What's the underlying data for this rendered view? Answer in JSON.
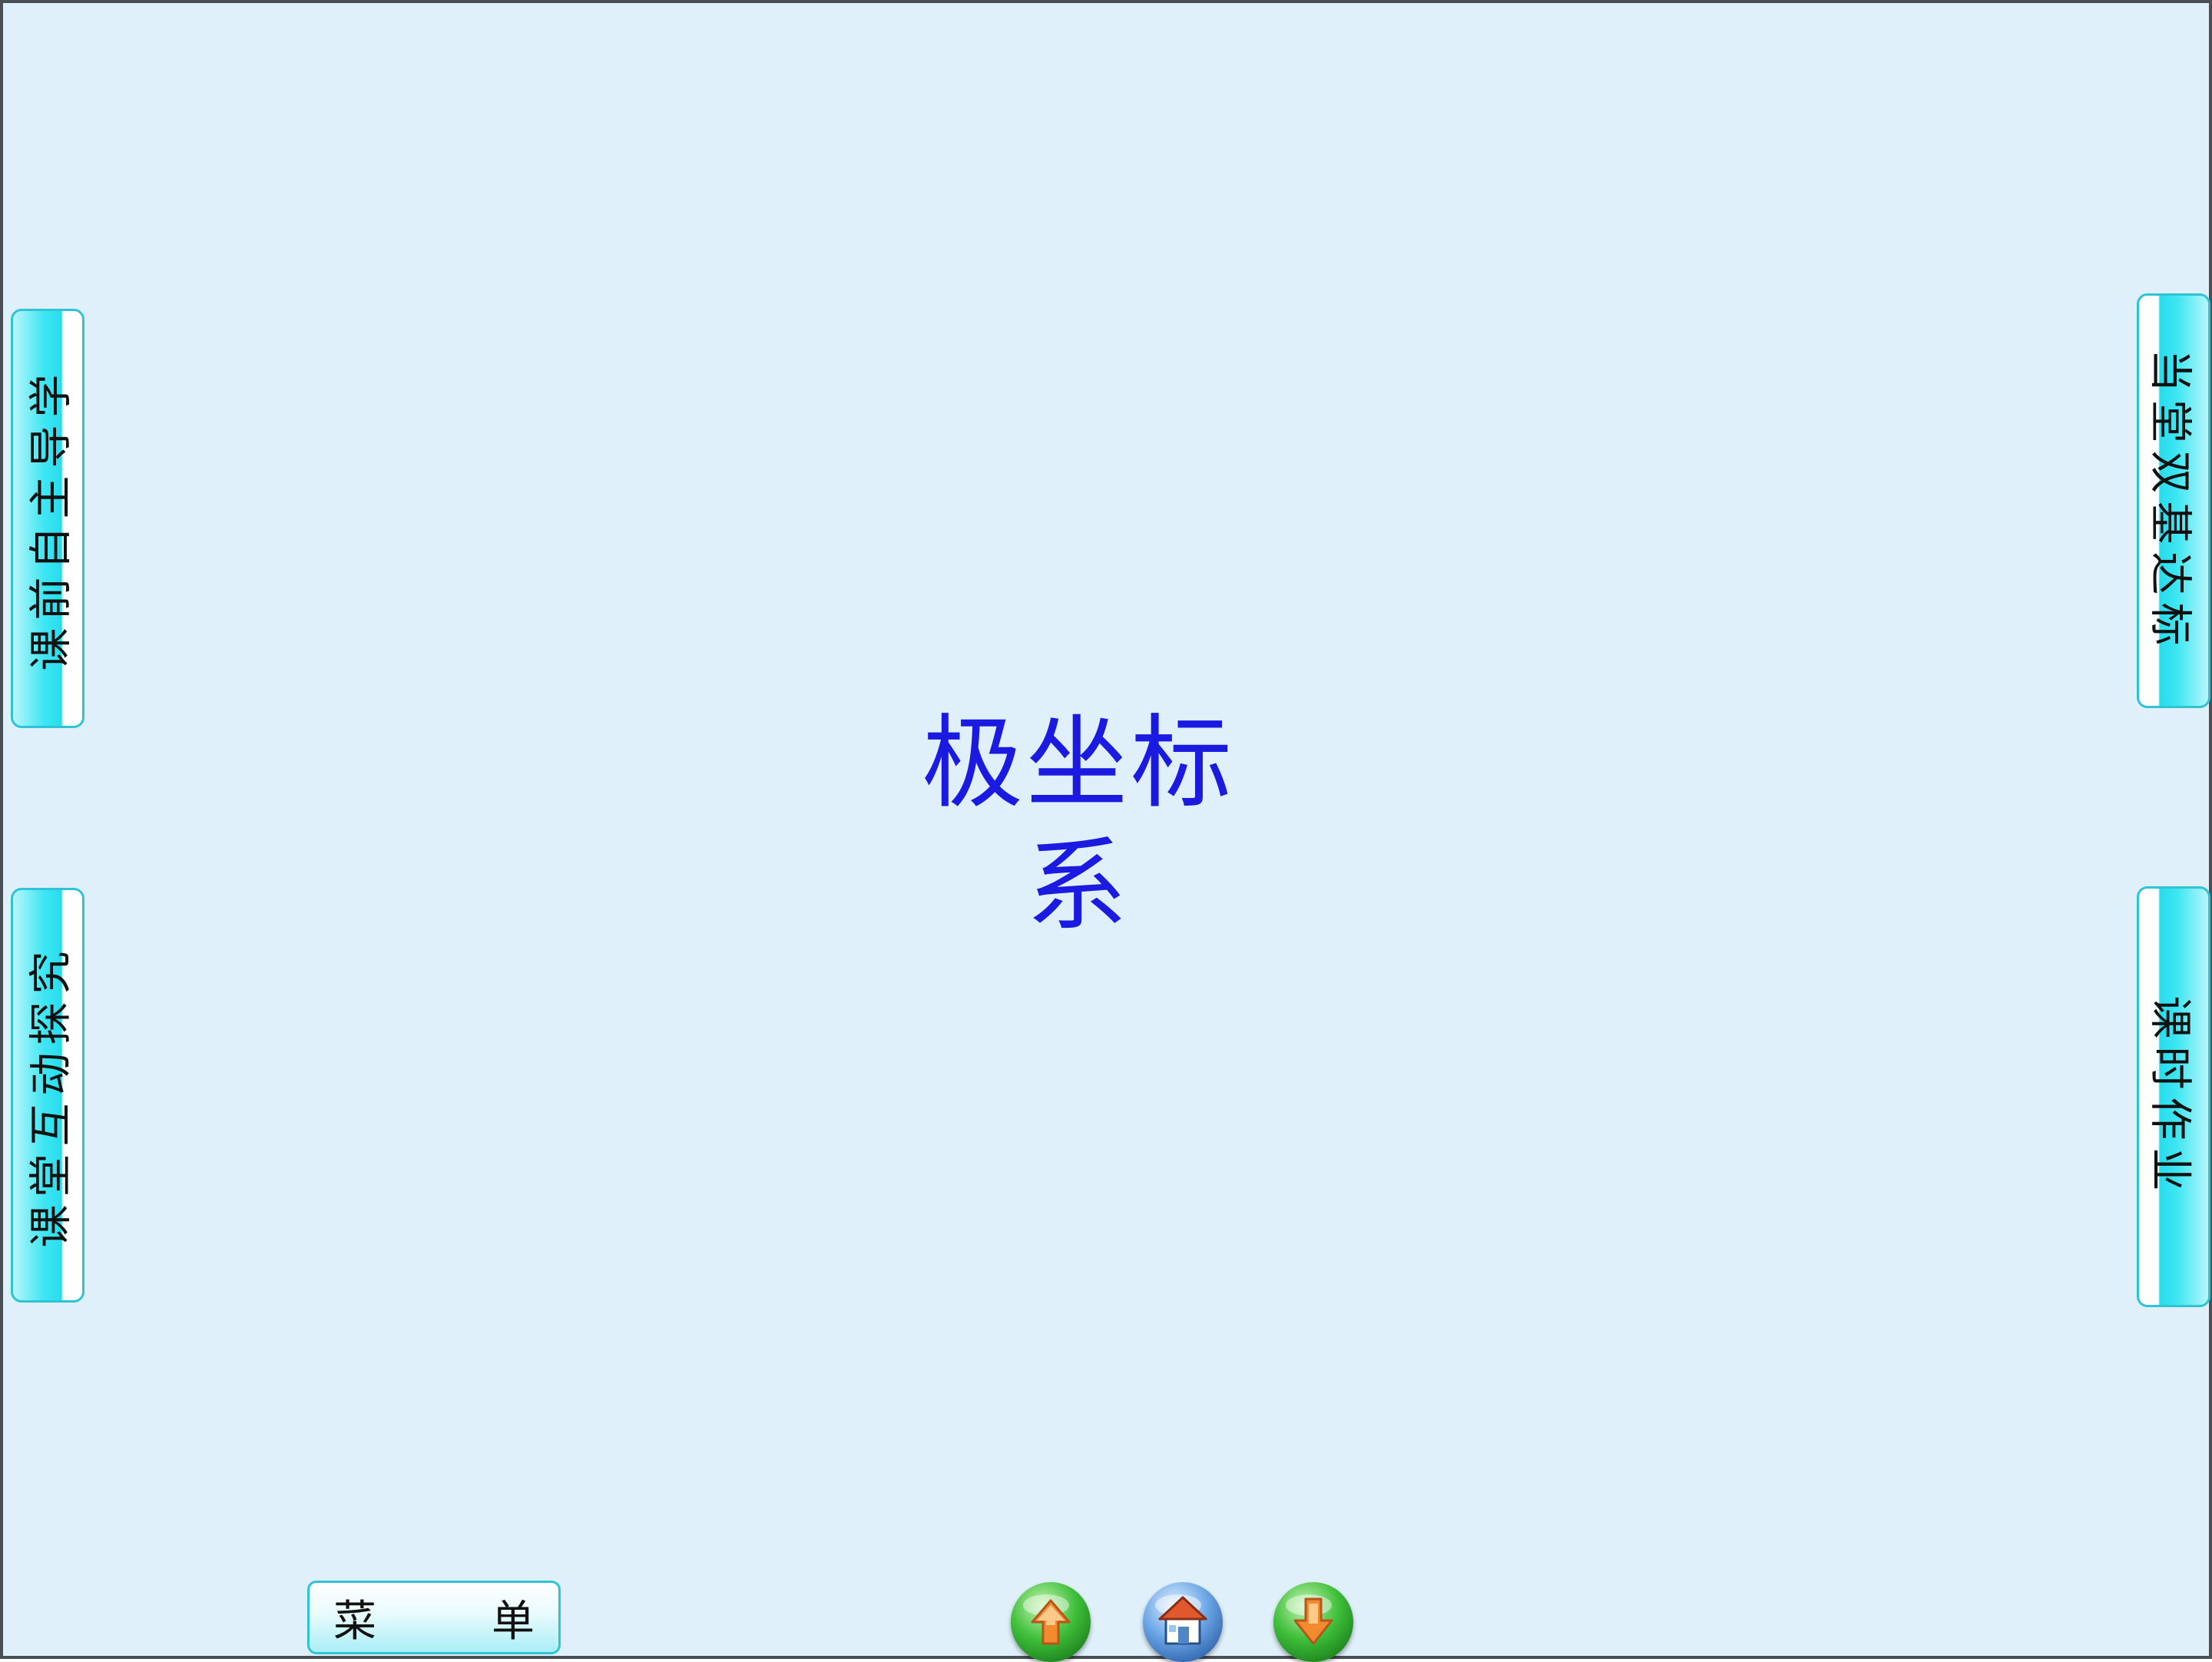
{
  "title": "极坐标系",
  "left_tabs": [
    {
      "label": "课前自主导学"
    },
    {
      "label": "课堂互动探究"
    }
  ],
  "right_tabs": [
    {
      "label": "当堂双基达标"
    },
    {
      "label": "课时作业"
    }
  ],
  "menu": {
    "label": "菜单"
  },
  "navigation": {
    "previous_icon": "up-arrow-icon",
    "home_icon": "home-icon",
    "next_icon": "down-arrow-icon"
  },
  "colors": {
    "background": "#dff0fb",
    "title": "#1a1ae0",
    "tab_accent": "#27dced",
    "tab_border": "#2ec4d6"
  }
}
